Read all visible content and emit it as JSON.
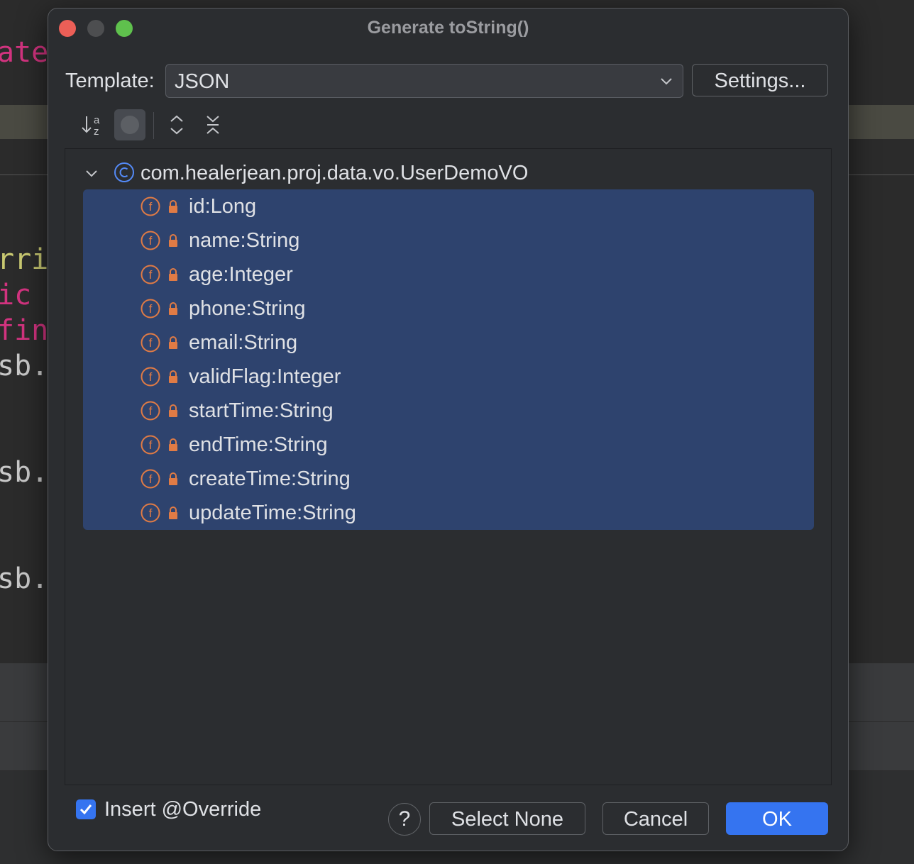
{
  "background_code": {
    "lines": [
      {
        "text": "ate",
        "color": "#d2337f"
      },
      {
        "text": "rri",
        "color": "#c9c971"
      },
      {
        "text": "ic",
        "color": "#d2337f"
      },
      {
        "text": "fin",
        "color": "#d2337f"
      },
      {
        "text": "sb.",
        "color": "#c8c8c8"
      },
      {
        "text": "sb.",
        "color": "#c8c8c8"
      },
      {
        "text": "sb.",
        "color": "#c8c8c8"
      }
    ]
  },
  "dialog": {
    "title": "Generate toString()",
    "template_label": "Template:",
    "template_value": "JSON",
    "settings_button": "Settings...",
    "toolbar_icons": [
      "sort-alphabetically-icon",
      "toggle-icon",
      "expand-all-icon",
      "collapse-all-icon"
    ],
    "tree": {
      "root_label": "com.healerjean.proj.data.vo.UserDemoVO",
      "fields": [
        "id:Long",
        "name:String",
        "age:Integer",
        "phone:String",
        "email:String",
        "validFlag:Integer",
        "startTime:String",
        "endTime:String",
        "createTime:String",
        "updateTime:String"
      ]
    },
    "insert_override_label": "Insert @Override",
    "insert_override_checked": true,
    "help_button": "?",
    "select_none_button": "Select None",
    "cancel_button": "Cancel",
    "ok_button": "OK"
  },
  "colors": {
    "accent": "#3574f0",
    "selection": "#2e436e",
    "field_icon": "#e07b45",
    "class_icon": "#548af7",
    "traffic_close": "#ec5f57",
    "traffic_max": "#5fc14d"
  }
}
